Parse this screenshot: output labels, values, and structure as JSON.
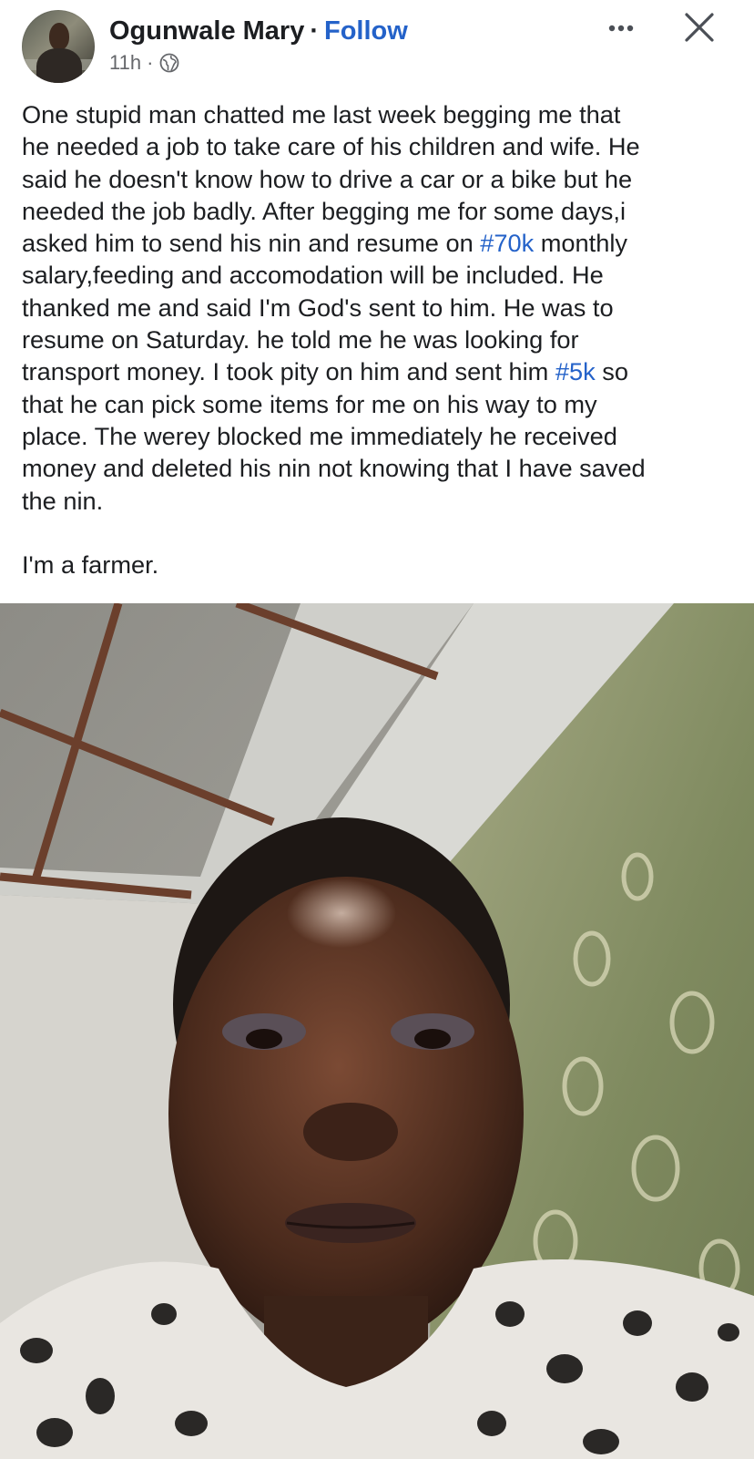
{
  "post": {
    "author": "Ogunwale Mary",
    "separator": "·",
    "follow_label": "Follow",
    "timestamp": "11h",
    "meta_separator": "·",
    "privacy_icon": "globe-icon",
    "lines": [
      "One stupid man chatted me last week begging me that",
      "he needed a job to take care of his children and wife. He",
      "said he doesn't know how to drive a car or a bike but he",
      "needed the job badly. After begging me for some days,i"
    ],
    "line5_before": "asked him to send his nin and resume on ",
    "hashtag_1": "#70k",
    "line5_after": " monthly",
    "lines_mid": [
      "salary,feeding and accomodation will be included. He",
      "thanked me and said I'm God's sent to him. He was to",
      "resume on Saturday. he told me he was looking for"
    ],
    "line9_before": "transport money. I took pity on him and sent him ",
    "hashtag_2": "#5k",
    "line9_after": " so",
    "lines_end": [
      "that he can pick some items for me on his way to my",
      "place. The werey blocked me immediately he received",
      "money and deleted his nin not knowing that I have saved",
      "the nin."
    ],
    "closing": "I'm a farmer.",
    "photo_icon": "selfie-photo"
  },
  "colors": {
    "link": "#2462c9",
    "text": "#1c1e21",
    "meta": "#65676b"
  }
}
